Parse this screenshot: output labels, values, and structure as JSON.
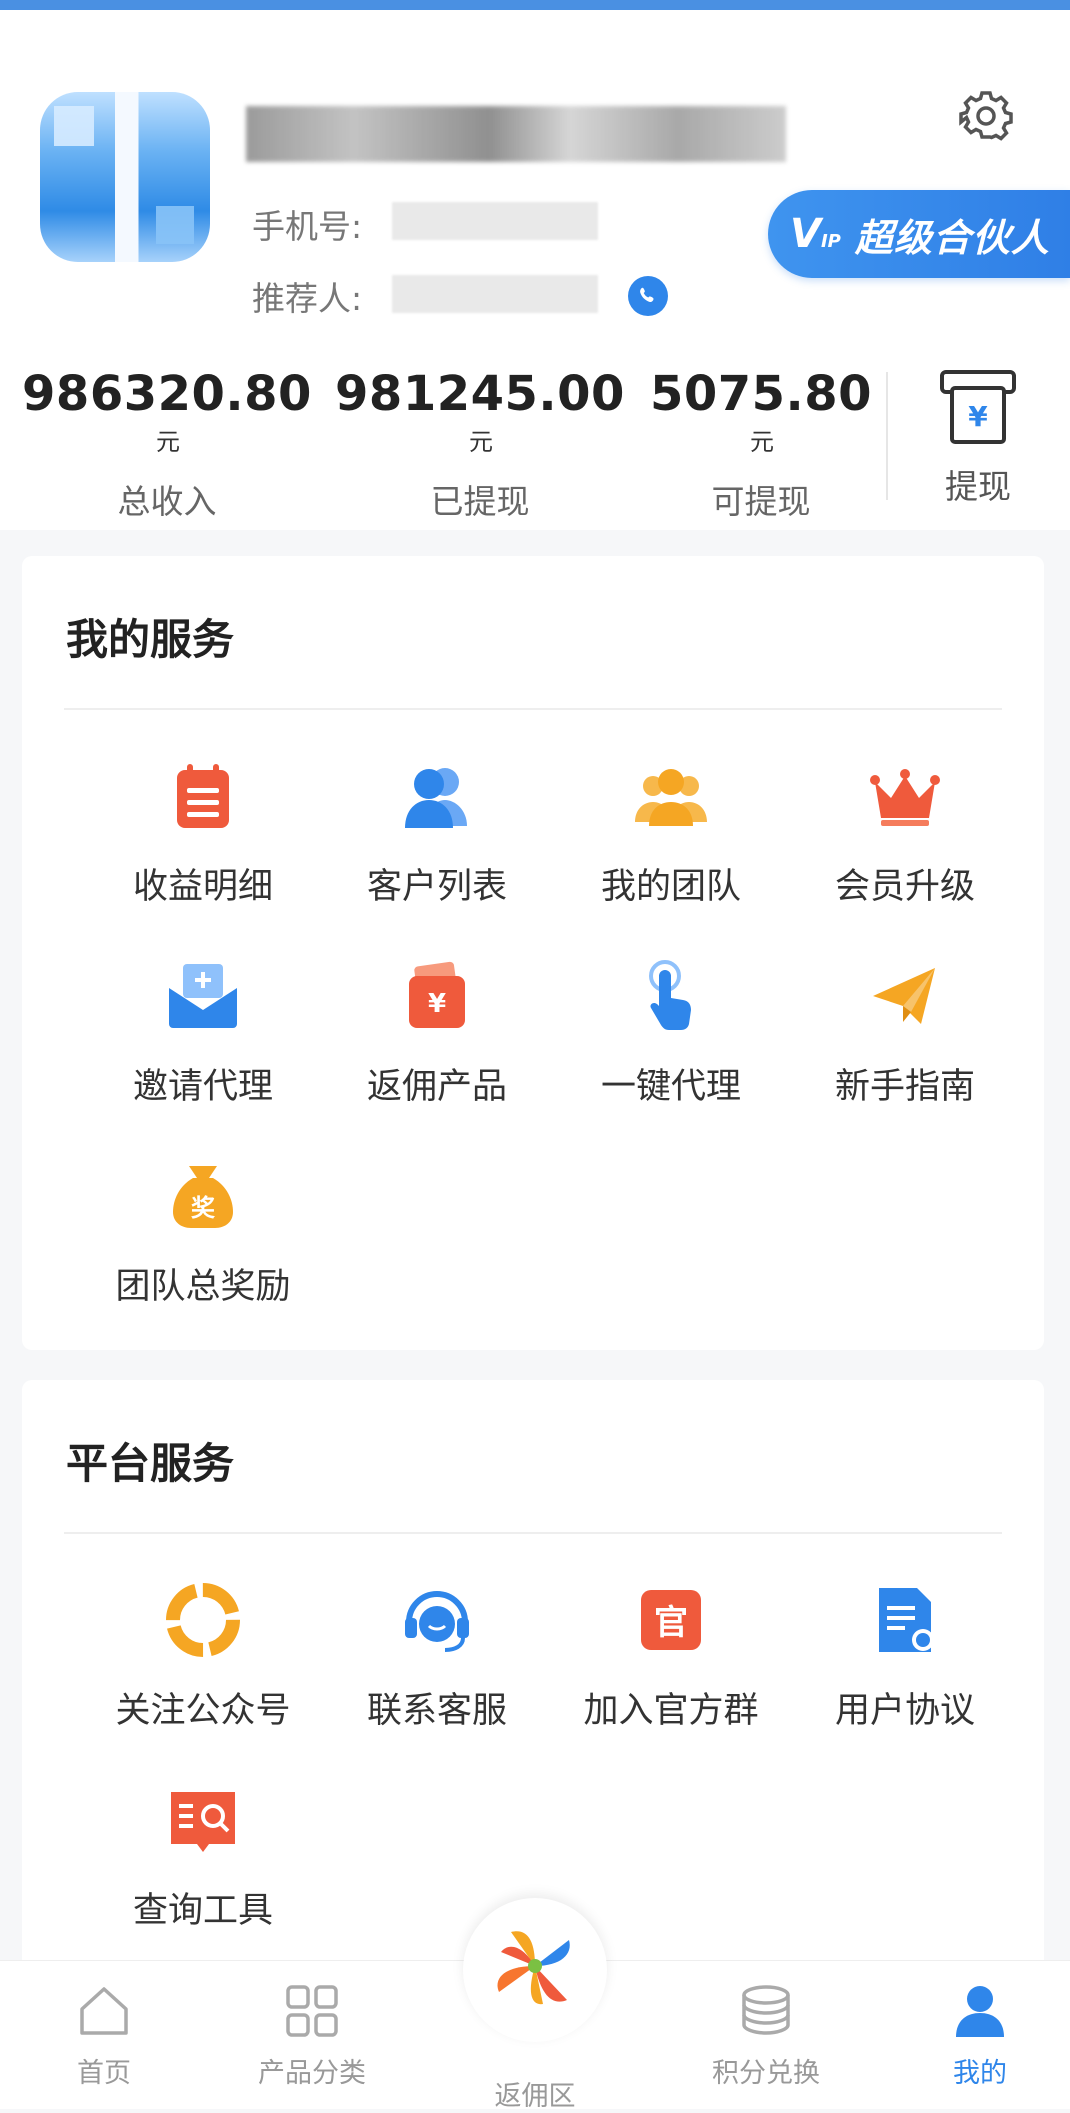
{
  "profile": {
    "phone_label": "手机号:",
    "referrer_label": "推荐人:",
    "vip_badge": "V",
    "vip_badge_small": "IP",
    "vip_title": "超级合伙人"
  },
  "stats": {
    "total_income": {
      "value": "986320.80",
      "unit": "元",
      "label": "总收入"
    },
    "withdrawn": {
      "value": "981245.00",
      "unit": "元",
      "label": "已提现"
    },
    "available": {
      "value": "5075.80",
      "unit": "元",
      "label": "可提现"
    },
    "withdraw_button": "提现"
  },
  "my_services": {
    "title": "我的服务",
    "items": [
      {
        "label": "收益明细",
        "icon": "clipboard-list-icon"
      },
      {
        "label": "客户列表",
        "icon": "users-icon"
      },
      {
        "label": "我的团队",
        "icon": "team-icon"
      },
      {
        "label": "会员升级",
        "icon": "crown-icon"
      },
      {
        "label": "邀请代理",
        "icon": "envelope-plus-icon"
      },
      {
        "label": "返佣产品",
        "icon": "wallet-yen-icon"
      },
      {
        "label": "一键代理",
        "icon": "tap-hand-icon"
      },
      {
        "label": "新手指南",
        "icon": "paper-plane-icon"
      },
      {
        "label": "团队总奖励",
        "icon": "reward-bag-icon"
      }
    ]
  },
  "platform_services": {
    "title": "平台服务",
    "items": [
      {
        "label": "关注公众号",
        "icon": "aperture-icon"
      },
      {
        "label": "联系客服",
        "icon": "headset-icon"
      },
      {
        "label": "加入官方群",
        "icon": "official-group-icon"
      },
      {
        "label": "用户协议",
        "icon": "agreement-doc-icon"
      },
      {
        "label": "查询工具",
        "icon": "search-tool-icon"
      }
    ]
  },
  "tabbar": {
    "home": "首页",
    "categories": "产品分类",
    "rebate": "返佣区",
    "points": "积分兑换",
    "mine": "我的"
  },
  "colors": {
    "accent": "#2f86ea",
    "orange": "#f5a623",
    "red": "#ef5a3c"
  },
  "icons": {
    "settings": "gear-icon",
    "phone": "phone-icon",
    "withdraw": "withdraw-yen-icon"
  },
  "withdraw_symbol": "¥",
  "reward_char": "奖",
  "official_char": "官"
}
